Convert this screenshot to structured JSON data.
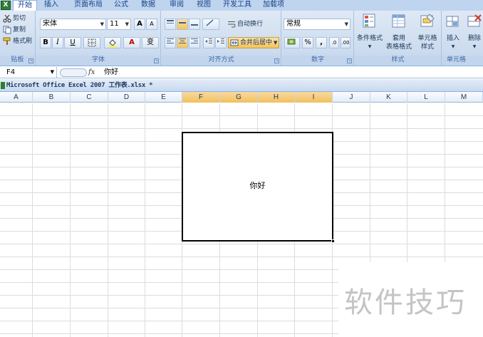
{
  "app_icon_letter": "X",
  "tabs": [
    "开始",
    "插入",
    "页面布局",
    "公式",
    "数据",
    "审阅",
    "视图",
    "开发工具",
    "加载项"
  ],
  "ribbon": {
    "clipboard": {
      "cut": "剪切",
      "copy": "复制",
      "format_painter": "格式刷",
      "label": "贴板"
    },
    "font": {
      "name": "宋体",
      "size": "11",
      "grow": "A",
      "shrink": "A",
      "bold": "B",
      "italic": "I",
      "underline": "U",
      "wen": "变",
      "label": "字体"
    },
    "alignment": {
      "wrap": "自动换行",
      "merge": "合并后居中",
      "label": "对齐方式"
    },
    "number": {
      "format": "常规",
      "percent": "%",
      "comma": ",",
      "label": "数字"
    },
    "styles": {
      "conditional": "条件格式",
      "table_line1": "套用",
      "table_line2": "表格格式",
      "cell_line1": "单元格",
      "cell_line2": "样式",
      "label": "样式"
    },
    "cells": {
      "insert": "插入",
      "delete": "删除",
      "label": "单元格"
    }
  },
  "formula_bar": {
    "name_box": "F4",
    "fx": "fx",
    "content": "你好"
  },
  "workbook_title": "Microsoft Office Excel 2007 工作表.xlsx *",
  "columns": [
    "A",
    "B",
    "C",
    "D",
    "E",
    "F",
    "G",
    "H",
    "I",
    "J",
    "K",
    "L",
    "M"
  ],
  "selected_columns": [
    "F",
    "G",
    "H",
    "I"
  ],
  "merged_cell_text": "你好",
  "watermark": "软件技巧"
}
